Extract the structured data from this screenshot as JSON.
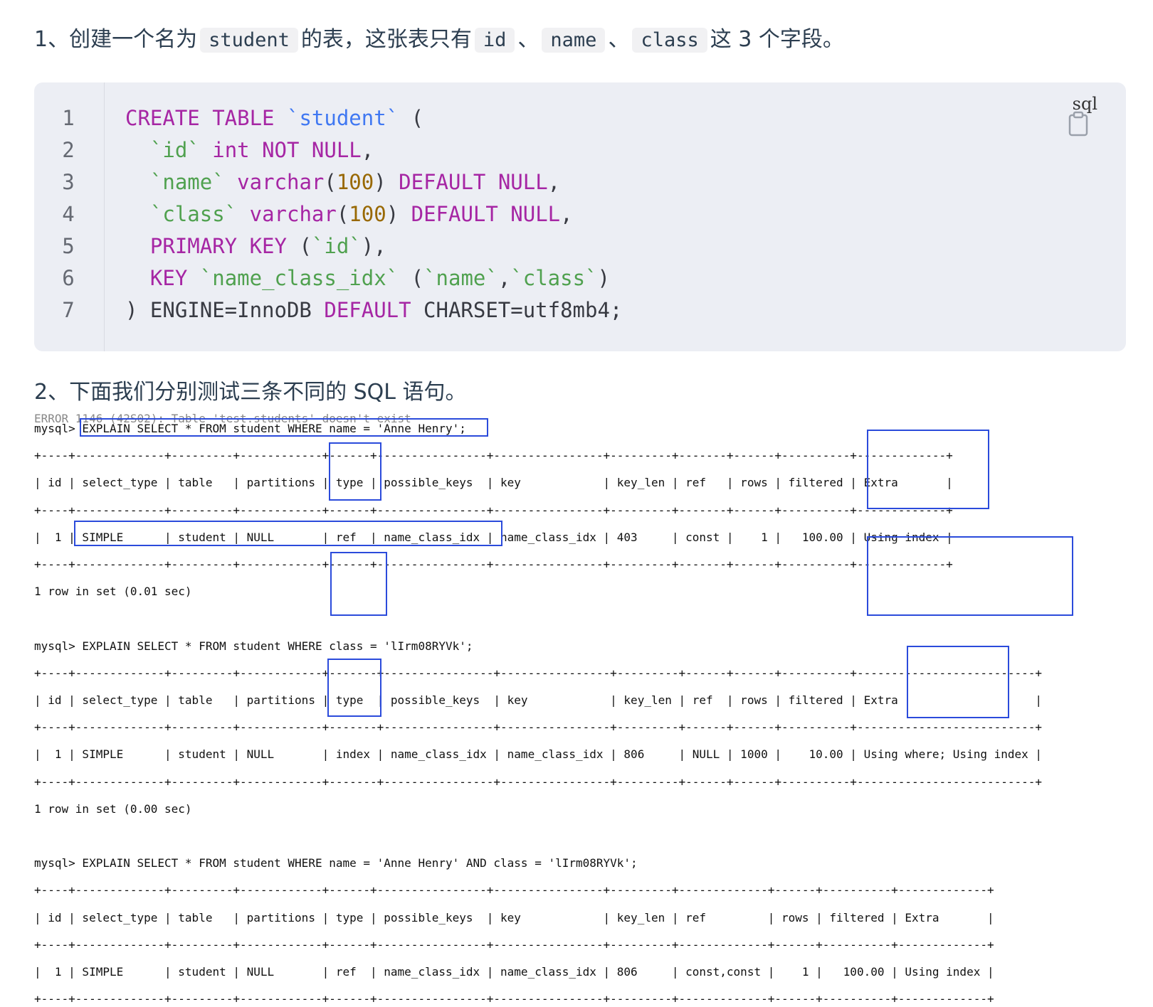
{
  "paragraph1": {
    "prefix": "1、创建一个名为",
    "code1": "student",
    "mid1": "的表，这张表只有",
    "code2": "id",
    "sep1": "、",
    "code3": "name",
    "sep2": "、",
    "code4": "class",
    "suffix": "这 3 个字段。"
  },
  "codeblock": {
    "language": "sql",
    "copy_icon": "clipboard-icon",
    "line_numbers": [
      "1",
      "2",
      "3",
      "4",
      "5",
      "6",
      "7"
    ],
    "lines": [
      [
        {
          "t": "CREATE TABLE ",
          "c": "kw"
        },
        {
          "t": "`student`",
          "c": "tbl"
        },
        {
          "t": " (",
          "c": ""
        }
      ],
      [
        {
          "t": "  ",
          "c": ""
        },
        {
          "t": "`id`",
          "c": "str"
        },
        {
          "t": " ",
          "c": ""
        },
        {
          "t": "int NOT NULL",
          "c": "kw"
        },
        {
          "t": ",",
          "c": ""
        }
      ],
      [
        {
          "t": "  ",
          "c": ""
        },
        {
          "t": "`name`",
          "c": "str"
        },
        {
          "t": " ",
          "c": ""
        },
        {
          "t": "varchar",
          "c": "kw"
        },
        {
          "t": "(",
          "c": ""
        },
        {
          "t": "100",
          "c": "num"
        },
        {
          "t": ") ",
          "c": ""
        },
        {
          "t": "DEFAULT NULL",
          "c": "kw"
        },
        {
          "t": ",",
          "c": ""
        }
      ],
      [
        {
          "t": "  ",
          "c": ""
        },
        {
          "t": "`class`",
          "c": "str"
        },
        {
          "t": " ",
          "c": ""
        },
        {
          "t": "varchar",
          "c": "kw"
        },
        {
          "t": "(",
          "c": ""
        },
        {
          "t": "100",
          "c": "num"
        },
        {
          "t": ") ",
          "c": ""
        },
        {
          "t": "DEFAULT NULL",
          "c": "kw"
        },
        {
          "t": ",",
          "c": ""
        }
      ],
      [
        {
          "t": "  ",
          "c": ""
        },
        {
          "t": "PRIMARY KEY",
          "c": "kw"
        },
        {
          "t": " (",
          "c": ""
        },
        {
          "t": "`id`",
          "c": "str"
        },
        {
          "t": "),",
          "c": ""
        }
      ],
      [
        {
          "t": "  ",
          "c": ""
        },
        {
          "t": "KEY",
          "c": "kw"
        },
        {
          "t": " ",
          "c": ""
        },
        {
          "t": "`name_class_idx`",
          "c": "str"
        },
        {
          "t": " (",
          "c": ""
        },
        {
          "t": "`name`",
          "c": "str"
        },
        {
          "t": ",",
          "c": ""
        },
        {
          "t": "`class`",
          "c": "str"
        },
        {
          "t": ")",
          "c": ""
        }
      ],
      [
        {
          "t": ") ENGINE=InnoDB ",
          "c": ""
        },
        {
          "t": "DEFAULT",
          "c": "kw"
        },
        {
          "t": " CHARSET=utf8mb4;",
          "c": ""
        }
      ]
    ]
  },
  "paragraph2": {
    "text": "2、下面我们分别测试三条不同的 SQL 语句。"
  },
  "terminal": {
    "cut_text": "ERROR 1146 (42S02): Table 'test.students' doesn't exist",
    "lines": [
      "mysql> EXPLAIN SELECT * FROM student WHERE name = 'Anne Henry';",
      "+----+-------------+---------+------------+------+----------------+----------------+---------+-------+------+----------+-------------+",
      "| id | select_type | table   | partitions | type | possible_keys  | key            | key_len | ref   | rows | filtered | Extra       |",
      "+----+-------------+---------+------------+------+----------------+----------------+---------+-------+------+----------+-------------+",
      "|  1 | SIMPLE      | student | NULL       | ref  | name_class_idx | name_class_idx | 403     | const |    1 |   100.00 | Using index |",
      "+----+-------------+---------+------------+------+----------------+----------------+---------+-------+------+----------+-------------+",
      "1 row in set (0.01 sec)",
      "",
      "mysql> EXPLAIN SELECT * FROM student WHERE class = 'lIrm08RYVk';",
      "+----+-------------+---------+------------+-------+----------------+----------------+---------+------+------+----------+--------------------------+",
      "| id | select_type | table   | partitions | type  | possible_keys  | key            | key_len | ref  | rows | filtered | Extra                    |",
      "+----+-------------+---------+------------+-------+----------------+----------------+---------+------+------+----------+--------------------------+",
      "|  1 | SIMPLE      | student | NULL       | index | name_class_idx | name_class_idx | 806     | NULL | 1000 |    10.00 | Using where; Using index |",
      "+----+-------------+---------+------------+-------+----------------+----------------+---------+------+------+----------+--------------------------+",
      "1 row in set (0.00 sec)",
      "",
      "mysql> EXPLAIN SELECT * FROM student WHERE name = 'Anne Henry' AND class = 'lIrm08RYVk';",
      "+----+-------------+---------+------------+------+----------------+----------------+---------+-------------+------+----------+-------------+",
      "| id | select_type | table   | partitions | type | possible_keys  | key            | key_len | ref         | rows | filtered | Extra       |",
      "+----+-------------+---------+------------+------+----------------+----------------+---------+-------------+------+----------+-------------+",
      "|  1 | SIMPLE      | student | NULL       | ref  | name_class_idx | name_class_idx | 806     | const,const |    1 |   100.00 | Using index |",
      "+----+-------------+---------+------------+------+----------------+----------------+---------+-------------+------+----------+-------------+"
    ],
    "highlight_color": "#2b4bdb"
  }
}
